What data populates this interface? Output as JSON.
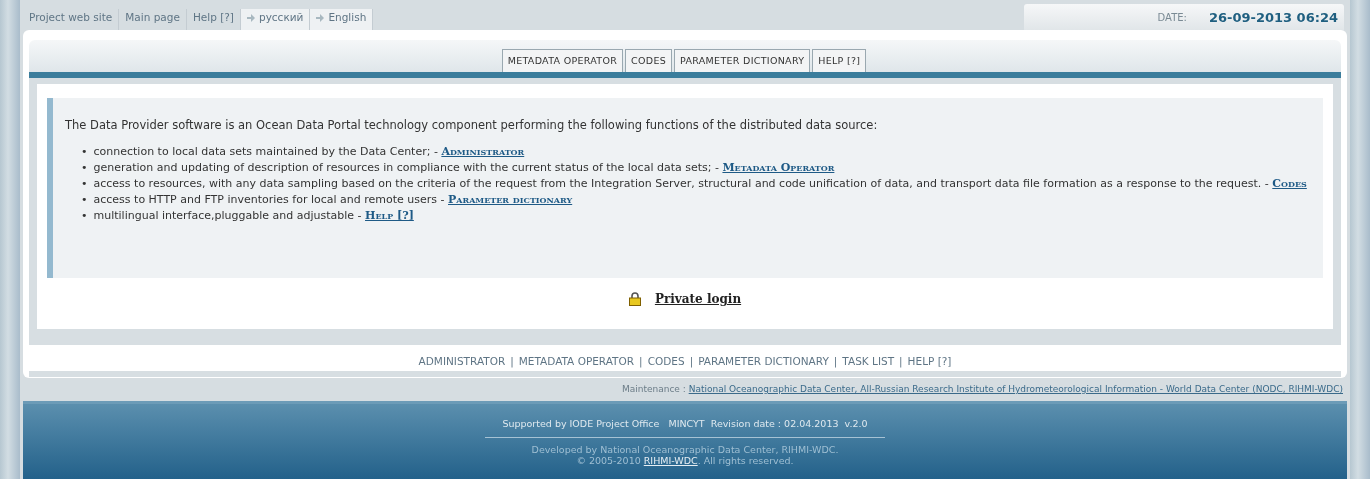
{
  "top_links": [
    {
      "label": "Project web site",
      "kind": "plain"
    },
    {
      "label": "Main page",
      "kind": "plain"
    },
    {
      "label": "Help [?]",
      "kind": "plain"
    },
    {
      "label": "русский",
      "kind": "language"
    },
    {
      "label": "English",
      "kind": "language"
    }
  ],
  "date": {
    "label": "DATE:",
    "value": "26-09-2013 06:24"
  },
  "tabs": [
    {
      "label": "METADATA OPERATOR"
    },
    {
      "label": "CODES"
    },
    {
      "label": "PARAMETER DICTIONARY"
    },
    {
      "label": "HELP [?]"
    }
  ],
  "intro": "The Data Provider software is an Ocean Data Portal technology component performing the following functions of the distributed data source:",
  "bullet": "•",
  "functions": [
    {
      "text": "connection to local data sets maintained by the Data Center; -",
      "link": "Administrator"
    },
    {
      "text": "generation and updating of description of resources in compliance with the current status of the local data sets; -",
      "link": "Metadata Operator"
    },
    {
      "text": "access to resources, with any data sampling based on the criteria of the request from the Integration Server, structural and code unification of data, and transport data file formation as a response to the request. -",
      "link": "Codes"
    },
    {
      "text": "access to HTTP and FTP inventories for local and remote users -",
      "link": "Parameter dictionary"
    },
    {
      "text": "multilingual interface,pluggable and adjustable -",
      "link": "Help [?]"
    }
  ],
  "login": {
    "label": "Private login"
  },
  "bottom_nav": {
    "separator": "|",
    "links": [
      "ADMINISTRATOR",
      "METADATA OPERATOR",
      "CODES",
      "PARAMETER DICTIONARY",
      "TASK LIST",
      "HELP [?]"
    ]
  },
  "maintenance": {
    "label": "Maintenance :",
    "link": "National Oceanographic Data Center, All-Russian Research Institute of Hydrometeorological Information - World Data Center (NODC, RIHMI-WDC)"
  },
  "footer": {
    "support": "Supported by IODE Project Office   MINCYT  Revision date : 02.04.2013  v.2.0",
    "developed": "Developed by National Oceanographic Data Center, RIHMI-WDC.",
    "copyright_prefix": "© 2005-2010",
    "copyright_link": "RIHMI-WDC",
    "copyright_suffix": ". All rights reserved."
  }
}
